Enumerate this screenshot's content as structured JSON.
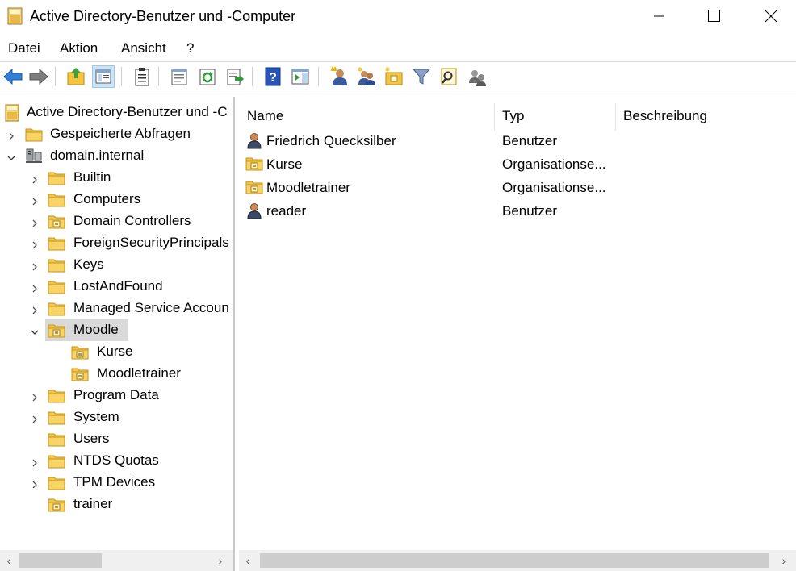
{
  "window": {
    "title": "Active Directory-Benutzer und -Computer"
  },
  "menu": [
    "Datei",
    "Aktion",
    "Ansicht",
    "?"
  ],
  "toolbar": [
    "back-arrow-icon",
    "forward-arrow-icon",
    "up-folder-icon",
    "show-console-tree-icon",
    "clipboard-icon",
    "properties-icon",
    "refresh-icon",
    "export-list-icon",
    "help-icon",
    "show-action-pane-icon",
    "new-user-icon",
    "new-group-icon",
    "new-ou-icon",
    "filter-icon",
    "find-icon",
    "add-to-group-icon"
  ],
  "tree": {
    "root": "Active Directory-Benutzer und -C",
    "saved_queries": "Gespeicherte Abfragen",
    "domain": "domain.internal",
    "children": [
      {
        "label": "Builtin",
        "expander": "collapsed",
        "icon": "folder"
      },
      {
        "label": "Computers",
        "expander": "collapsed",
        "icon": "folder"
      },
      {
        "label": "Domain Controllers",
        "expander": "collapsed",
        "icon": "ou"
      },
      {
        "label": "ForeignSecurityPrincipals",
        "expander": "collapsed",
        "icon": "folder"
      },
      {
        "label": "Keys",
        "expander": "collapsed",
        "icon": "folder"
      },
      {
        "label": "LostAndFound",
        "expander": "collapsed",
        "icon": "folder"
      },
      {
        "label": "Managed Service Accoun",
        "expander": "collapsed",
        "icon": "folder"
      },
      {
        "label": "Moodle",
        "expander": "expanded",
        "icon": "ou",
        "selected": true
      },
      {
        "label": "Kurse",
        "expander": "none",
        "icon": "ou",
        "indent": 2
      },
      {
        "label": "Moodletrainer",
        "expander": "none",
        "icon": "ou",
        "indent": 2
      },
      {
        "label": "Program Data",
        "expander": "collapsed",
        "icon": "folder"
      },
      {
        "label": "System",
        "expander": "collapsed",
        "icon": "folder"
      },
      {
        "label": "Users",
        "expander": "none",
        "icon": "folder"
      },
      {
        "label": "NTDS Quotas",
        "expander": "collapsed",
        "icon": "folder"
      },
      {
        "label": "TPM Devices",
        "expander": "collapsed",
        "icon": "folder"
      },
      {
        "label": "trainer",
        "expander": "none",
        "icon": "ou"
      }
    ]
  },
  "list": {
    "columns": [
      "Name",
      "Typ",
      "Beschreibung"
    ],
    "rows": [
      {
        "name": "Friedrich Quecksilber",
        "type": "Benutzer",
        "icon": "user"
      },
      {
        "name": "Kurse",
        "type": "Organisationse...",
        "icon": "ou"
      },
      {
        "name": "Moodletrainer",
        "type": "Organisationse...",
        "icon": "ou"
      },
      {
        "name": "reader",
        "type": "Benutzer",
        "icon": "user"
      }
    ]
  },
  "colors": {
    "folder": "#f5c542",
    "selection": "#d9d9d9",
    "accent_blue": "#2f7fd9"
  }
}
